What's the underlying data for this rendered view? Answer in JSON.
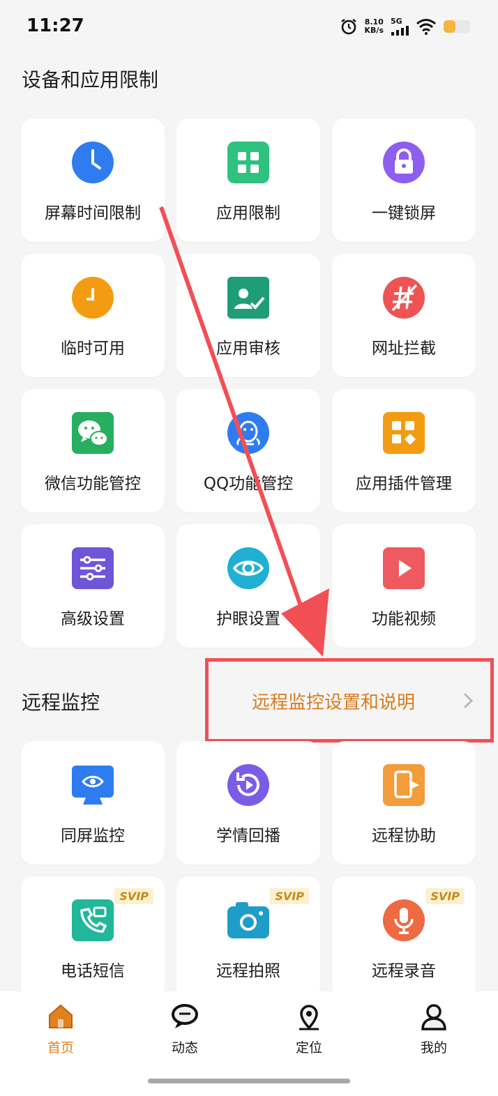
{
  "status_bar": {
    "time": "11:27",
    "net_speed_value": "8.10",
    "net_speed_unit": "KB/s",
    "network": "5G",
    "icons": [
      "alarm-icon",
      "signal-icon",
      "wifi-icon",
      "battery-icon"
    ],
    "battery_level": 0.45
  },
  "section_device": {
    "title": "设备和应用限制",
    "items": [
      {
        "label": "屏幕时间限制",
        "icon": "clock-icon",
        "color": "#2f7cf0"
      },
      {
        "label": "应用限制",
        "icon": "grid-apps-icon",
        "color": "#2ec27e"
      },
      {
        "label": "一键锁屏",
        "icon": "lock-icon",
        "color": "#8e5ef0"
      },
      {
        "label": "临时可用",
        "icon": "temp-clock-icon",
        "color": "#f39c12"
      },
      {
        "label": "应用审核",
        "icon": "app-review-icon",
        "color": "#1f9d77"
      },
      {
        "label": "网址拦截",
        "icon": "url-block-icon",
        "color": "#ee5454"
      },
      {
        "label": "微信功能管控",
        "icon": "wechat-icon",
        "color": "#27ae60"
      },
      {
        "label": "QQ功能管控",
        "icon": "qq-icon",
        "color": "#2f7cf0"
      },
      {
        "label": "应用插件管理",
        "icon": "plugin-icon",
        "color": "#f39c12"
      },
      {
        "label": "高级设置",
        "icon": "sliders-icon",
        "color": "#6f55d8"
      },
      {
        "label": "护眼设置",
        "icon": "eye-icon",
        "color": "#1fb0d3"
      },
      {
        "label": "功能视频",
        "icon": "play-icon",
        "color": "#ee5a5f"
      }
    ]
  },
  "section_remote": {
    "title": "远程监控",
    "link_label": "远程监控设置和说明",
    "items": [
      {
        "label": "同屏监控",
        "icon": "screen-mirror-icon",
        "color": "#2f7cf0",
        "badge": ""
      },
      {
        "label": "学情回播",
        "icon": "replay-icon",
        "color": "#7b5ce6",
        "badge": ""
      },
      {
        "label": "远程协助",
        "icon": "remote-assist-icon",
        "color": "#f39c3a",
        "badge": ""
      },
      {
        "label": "电话短信",
        "icon": "phone-sms-icon",
        "color": "#20b79a",
        "badge": "SVIP"
      },
      {
        "label": "远程拍照",
        "icon": "camera-icon",
        "color": "#1f9dc9",
        "badge": "SVIP"
      },
      {
        "label": "远程录音",
        "icon": "microphone-icon",
        "color": "#ee6a43",
        "badge": "SVIP"
      }
    ]
  },
  "bottom_nav": {
    "items": [
      {
        "label": "首页",
        "icon": "home-icon",
        "active": true
      },
      {
        "label": "动态",
        "icon": "chat-bubble-icon",
        "active": false
      },
      {
        "label": "定位",
        "icon": "location-pin-icon",
        "active": false
      },
      {
        "label": "我的",
        "icon": "profile-icon",
        "active": false
      }
    ],
    "accent_color": "#e0821e"
  }
}
